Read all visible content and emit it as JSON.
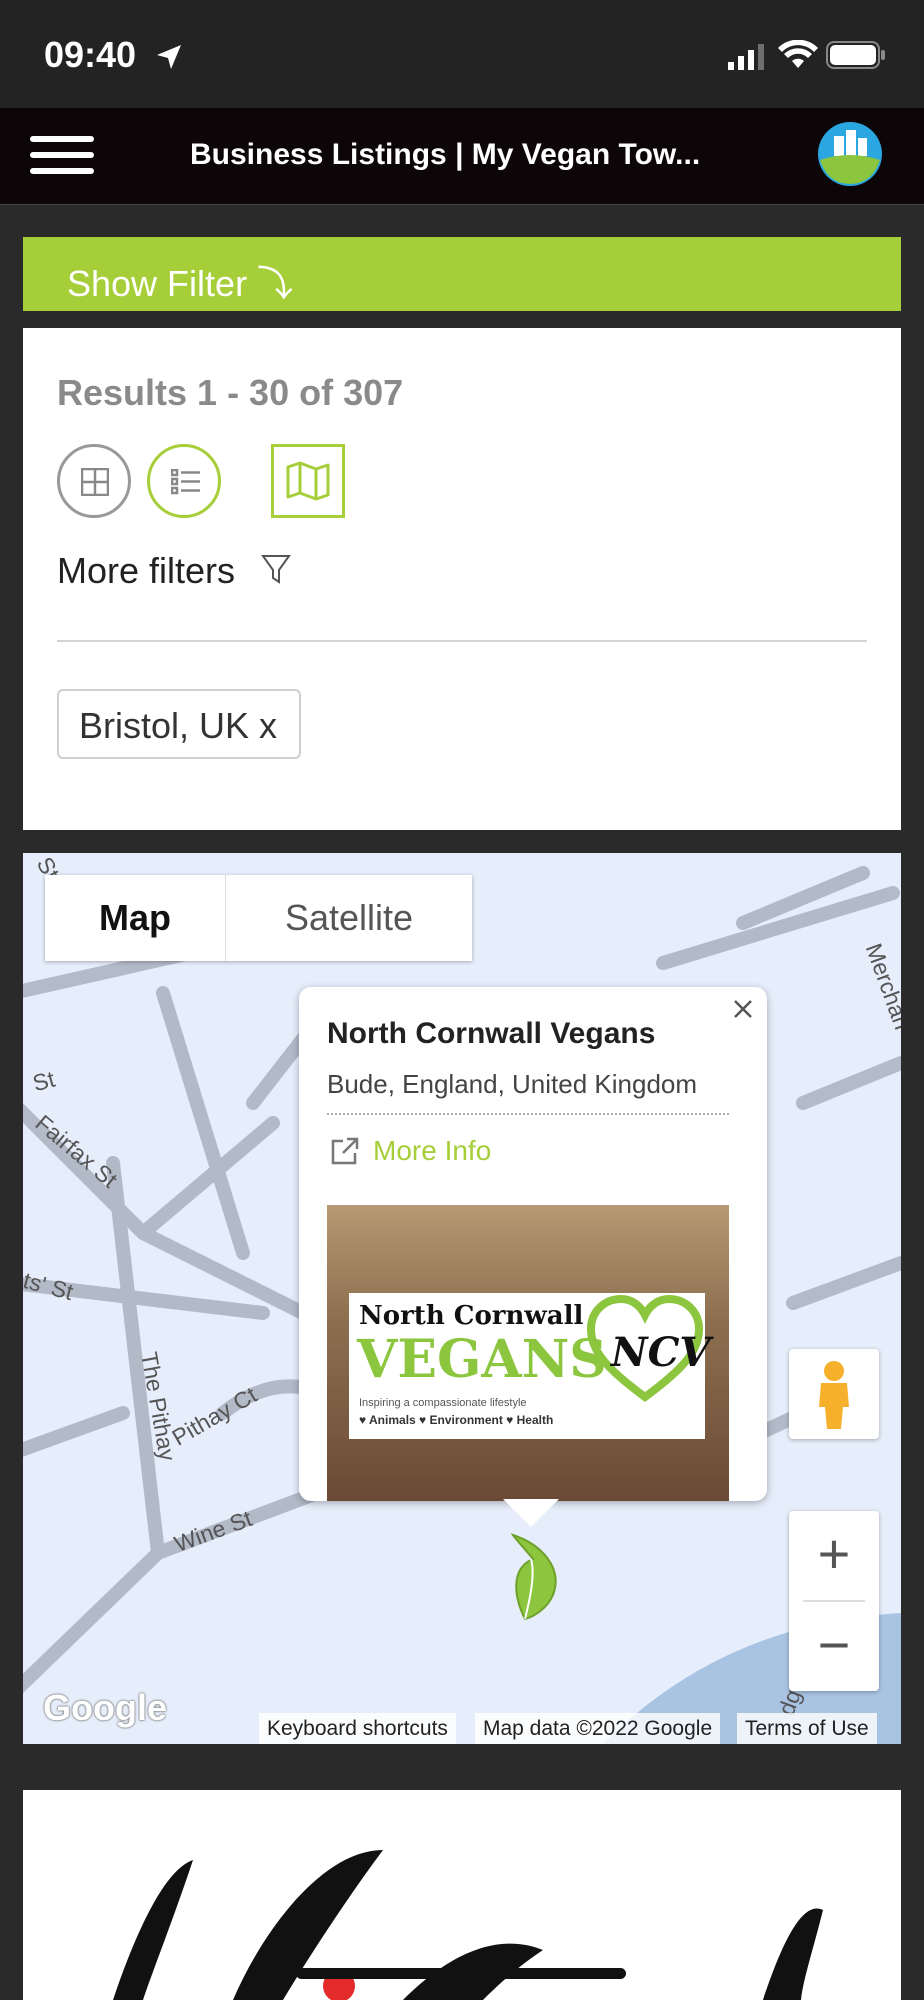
{
  "status_bar": {
    "time": "09:40"
  },
  "header": {
    "title": "Business Listings | My Vegan Tow..."
  },
  "filter_bar": {
    "label": "Show Filter ⤵"
  },
  "results": {
    "summary": "Results 1 - 30 of 307",
    "more_filters": "More filters",
    "chip": "Bristol, UK x"
  },
  "map": {
    "map_type": {
      "map": "Map",
      "satellite": "Satellite"
    },
    "roads": [
      "St",
      "Fairfax St",
      "ts' St",
      "The Pithay",
      "Pithay Ct",
      "Wine St",
      "Merchan",
      "dge",
      "St"
    ],
    "popup": {
      "title": "North Cornwall Vegans",
      "address": "Bude, England, United Kingdom",
      "more_info": "More Info",
      "image": {
        "line1": "North Cornwall",
        "line2": "VEGANS",
        "badge": "NCV",
        "tagline": "Inspiring a compassionate lifestyle",
        "pillars": "♥ Animals ♥ Environment ♥ Health"
      }
    },
    "zoom": {
      "in": "+",
      "out": "−"
    },
    "attribution": {
      "keyboard": "Keyboard shortcuts",
      "data": "Map data ©2022 Google",
      "terms": "Terms of Use"
    },
    "google": "Google"
  },
  "colors": {
    "brand_green": "#a6ce39",
    "header_bg": "#0c0608",
    "map_bg": "#e7eefb"
  }
}
